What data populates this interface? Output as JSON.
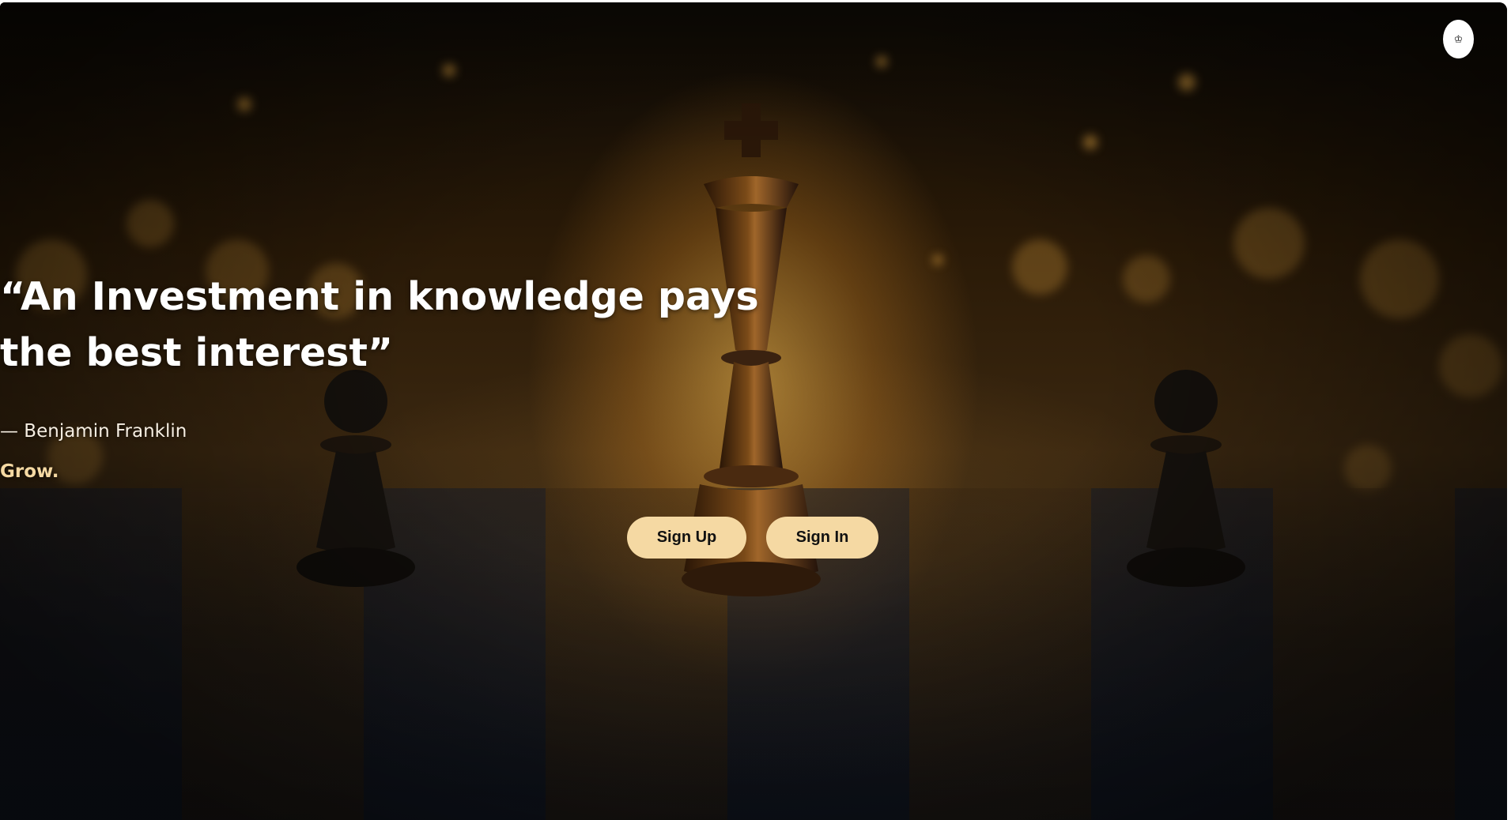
{
  "hero": {
    "quote_line1": "“An Investment in knowledge pays",
    "quote_line2": "the best interest”",
    "author": "— Benjamin Franklin",
    "tagline": "Grow."
  },
  "actions": {
    "sign_up_label": "Sign Up",
    "sign_in_label": "Sign In"
  },
  "corner_button": {
    "icon": "chess-king-icon",
    "glyph": "♔"
  },
  "colors": {
    "accent": "#f5d9a3",
    "quote_text": "#ffffff",
    "button_text": "#111111"
  }
}
